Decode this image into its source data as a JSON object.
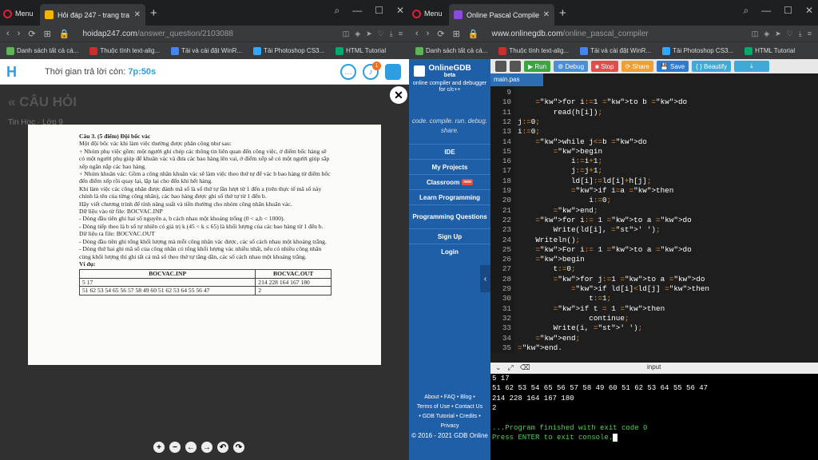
{
  "left_window": {
    "menu_label": "Menu",
    "tab_title": "Hỏi đáp 247 - trang tra lời",
    "url_domain": "hoidap247.com",
    "url_path": "/answer_question/2103088",
    "bookmarks": [
      "Danh sách tất cả cá...",
      "Thuộc tính text-alig...",
      "Tải và cài đặt WinR...",
      "Tải Photoshop CS3...",
      "HTML Tutorial"
    ],
    "timer_label": "Thời gian trả lời còn:",
    "timer_value": "7p:50s",
    "notification_count": "1",
    "page_title": "« CÂU HỎI",
    "page_subject": "Tin Học · Lớp 9",
    "doc": {
      "heading": "Câu 3. (5 điểm) Đội bốc vác",
      "paragraphs": [
        "Một đội bốc vác khi làm việc thường được phân công như sau:",
        "+ Nhóm phụ việc gồm: một người ghi chép các thông tin liên quan đến công việc, ở điểm bốc hàng sẽ có một người phụ giúp để khuân vác và đưa các bao hàng lên vai, ở điểm xếp sẽ có một người giúp sắp xếp ngăn nắp các bao hàng.",
        "+ Nhóm khuân vác: Gồm a công nhân khuân vác sẽ làm việc theo thứ tự để vác b bao hàng từ điểm bốc đến điểm xếp rồi quay lại, lặp lại cho đến khi hết hàng.",
        "Khi làm việc các công nhân được đánh mã số là số thứ tự lần lượt từ 1 đến a (trên thực tế mã số này chính là tên của từng công nhân), các bao hàng được ghi số thứ tự từ 1 đến b.",
        "Hãy viết chương trình để tính năng suất và tiền thưởng cho nhóm công nhân khuân vác.",
        "Dữ liệu vào từ file: BOCVAC.INP",
        "- Dòng đầu tiên ghi hai số nguyên a, b cách nhau một khoảng trống (0 < a,b < 1000).",
        "- Dòng tiếp theo là b số tự nhiên có giá trị k (45 < k ≤ 65) là khối lượng của các bao hàng từ 1 đến b.",
        "Dữ liệu ra file: BOCVAC.OUT",
        "- Dòng đầu tiên ghi tổng khối lượng mà mỗi công nhân vác được, các số cách nhau một khoảng trắng.",
        "- Dòng thứ hai ghi mã số của công nhân có tổng khối lượng vác nhiều nhất, nếu có nhiều công nhân cùng khối lượng thì ghi tất cả mã số theo thứ tự tăng dần, các số cách nhau một khoảng trắng."
      ],
      "example_label": "Ví dụ:",
      "table_headers": [
        "BOCVAC.INP",
        "BOCVAC.OUT"
      ],
      "table_rows": [
        [
          "5 17",
          "214 228 164 167 180"
        ],
        [
          "51 62 53 54 65 56 57 58 49 60 51 62 53 64 55 56 47",
          "2"
        ]
      ]
    },
    "zoom_controls": [
      "+",
      "−",
      "←",
      "→",
      "↶",
      "↷"
    ]
  },
  "right_window": {
    "menu_label": "Menu",
    "tab_title": "Online Pascal Compiler - o",
    "url_domain": "www.onlinegdb.com",
    "url_path": "/online_pascal_compiler",
    "bookmarks": [
      "Danh sách tất cả cá...",
      "Thuộc tính text-alig...",
      "Tải và cài đặt WinR...",
      "Tải Photoshop CS3...",
      "HTML Tutorial"
    ],
    "brand": {
      "name": "OnlineGDB",
      "beta": "beta",
      "desc": "online compiler and debugger for c/c++",
      "tagline": "code. compile. run. debug. share."
    },
    "menu": [
      "IDE",
      "My Projects",
      "Classroom",
      "Learn Programming",
      "Programming Questions",
      "Sign Up",
      "Login"
    ],
    "classroom_badge": "new",
    "footer": {
      "links1": "About • FAQ • Blog •",
      "links2": "Terms of Use • Contact Us",
      "links3": "• GDB Tutorial • Credits •",
      "links4": "Privacy",
      "copyright": "© 2016 - 2021 GDB Online"
    },
    "toolbar": {
      "run": "▶ Run",
      "debug": "⚙ Debug",
      "stop": "■ Stop",
      "share": "⟳ Share",
      "save": "💾 Save",
      "beautify": "{ } Beautify"
    },
    "file_tab": "main.pas",
    "code_lines": [
      {
        "n": "9",
        "t": ""
      },
      {
        "n": "10",
        "t": "    for i:=1 to b do"
      },
      {
        "n": "11",
        "t": "        read(h[i]);"
      },
      {
        "n": "12",
        "t": "j:=0;"
      },
      {
        "n": "13",
        "t": "i:=0;"
      },
      {
        "n": "14",
        "t": "    while j<=b do"
      },
      {
        "n": "15",
        "t": "        begin"
      },
      {
        "n": "16",
        "t": "            i:=i+1;"
      },
      {
        "n": "17",
        "t": "            j:=j+1;"
      },
      {
        "n": "18",
        "t": "            ld[i]:=ld[i]+h[j];"
      },
      {
        "n": "19",
        "t": "            if i=a then"
      },
      {
        "n": "20",
        "t": "                i:=0;"
      },
      {
        "n": "21",
        "t": "        end;"
      },
      {
        "n": "22",
        "t": "    for i:= 1 to a do"
      },
      {
        "n": "23",
        "t": "        Write(ld[i], ' ');"
      },
      {
        "n": "24",
        "t": "    Writeln();"
      },
      {
        "n": "25",
        "t": "    For i:= 1 to a do"
      },
      {
        "n": "26",
        "t": "    begin"
      },
      {
        "n": "27",
        "t": "        t:=0;"
      },
      {
        "n": "28",
        "t": "        for j:=1 to a do"
      },
      {
        "n": "29",
        "t": "            if ld[i]<ld[j] then"
      },
      {
        "n": "30",
        "t": "                t:=1;"
      },
      {
        "n": "31",
        "t": "        if t = 1 then"
      },
      {
        "n": "32",
        "t": "                continue;"
      },
      {
        "n": "33",
        "t": "        Write(i, ' ');"
      },
      {
        "n": "34",
        "t": "    end;"
      },
      {
        "n": "35",
        "t": "end."
      }
    ],
    "io_label": "input",
    "console_lines": [
      {
        "t": "5 17",
        "c": ""
      },
      {
        "t": "51 62 53 54 65 56 57 58 49 60 51 62 53 64 55 56 47",
        "c": ""
      },
      {
        "t": "214 228 164 167 180",
        "c": ""
      },
      {
        "t": "2",
        "c": ""
      },
      {
        "t": "",
        "c": ""
      },
      {
        "t": "...Program finished with exit code 0",
        "c": "g"
      },
      {
        "t": "Press ENTER to exit console.",
        "c": "g"
      }
    ]
  }
}
